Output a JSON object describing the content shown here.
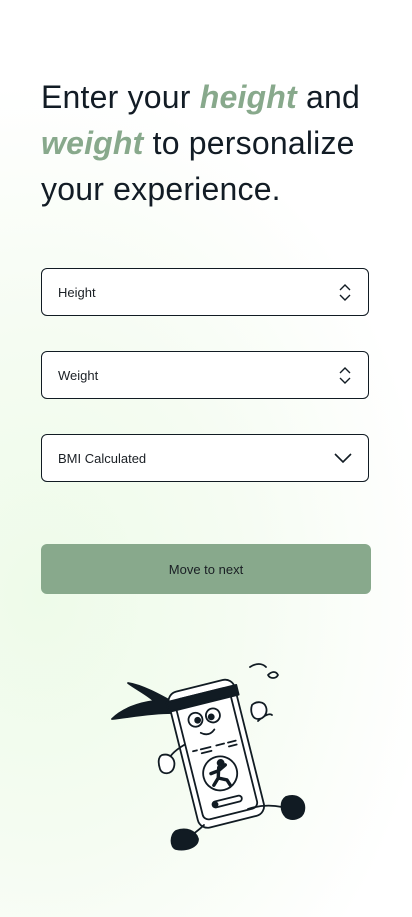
{
  "headline": {
    "part1": "Enter your ",
    "accent1": "height",
    "part2": " and ",
    "accent2": "weight",
    "part3": " to personalize your experience."
  },
  "form": {
    "height_label": "Height",
    "weight_label": "Weight",
    "bmi_label": "BMI Calculated"
  },
  "actions": {
    "next_label": "Move to next"
  },
  "colors": {
    "accent": "#88a98c",
    "text": "#121c25",
    "border": "#111b23"
  },
  "icons": {
    "height_stepper": "chevron-up-down-icon",
    "weight_stepper": "chevron-up-down-icon",
    "bmi_dropdown": "chevron-down-icon",
    "illustration": "running-phone-mascot"
  }
}
